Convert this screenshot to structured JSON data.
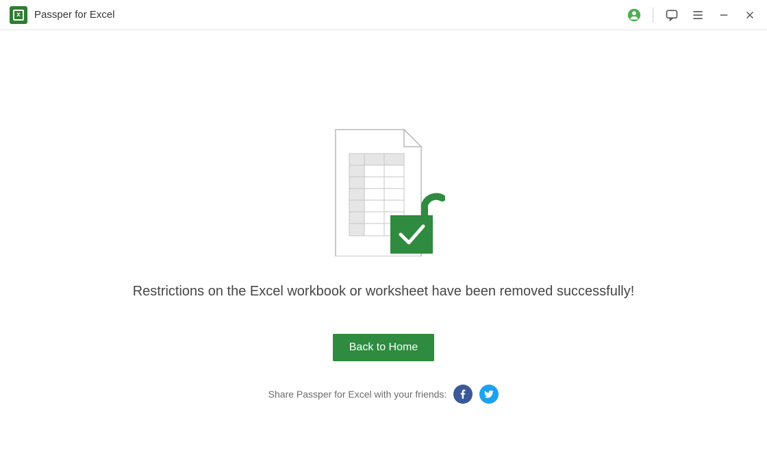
{
  "titlebar": {
    "app_title": "Passper for Excel"
  },
  "main": {
    "status_message": "Restrictions on the Excel workbook or worksheet have been removed successfully!",
    "back_button_label": "Back to Home",
    "share_label": "Share Passper for Excel with your friends:"
  },
  "colors": {
    "accent_green": "#2e8b3f",
    "facebook": "#3b5998",
    "twitter": "#1da1f2"
  }
}
